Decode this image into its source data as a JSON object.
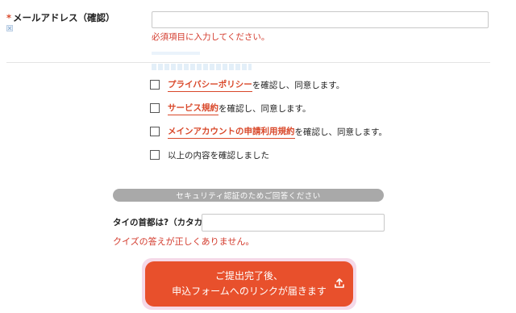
{
  "email_confirm": {
    "required_mark": "*",
    "label": "メールアドレス（確認）",
    "value": "",
    "error": "必須項目に入力してください。"
  },
  "agreements": [
    {
      "link": "プライバシーポリシー",
      "suffix": "を確認し、同意します。",
      "checked": false
    },
    {
      "link": "サービス規約",
      "suffix": "を確認し、同意します。",
      "checked": false
    },
    {
      "link": "メインアカウントの申請利用規約",
      "suffix": "を確認し、同意します。",
      "checked": false
    },
    {
      "link": "",
      "suffix": "以上の内容を確認しました",
      "checked": false
    }
  ],
  "quiz": {
    "banner": "セキュリティ認証のためご回答ください",
    "question": "タイの首都は?（カタカナ）",
    "value": "",
    "error": "クイズの答えが正しくありません。"
  },
  "submit": {
    "line1": "ご提出完了後、",
    "line2": "申込フォームへのリンクが届きます",
    "icon": "upload-icon"
  },
  "colors": {
    "accent": "#e8502c",
    "error": "#d33a2c",
    "banner": "#a9a9a9"
  }
}
